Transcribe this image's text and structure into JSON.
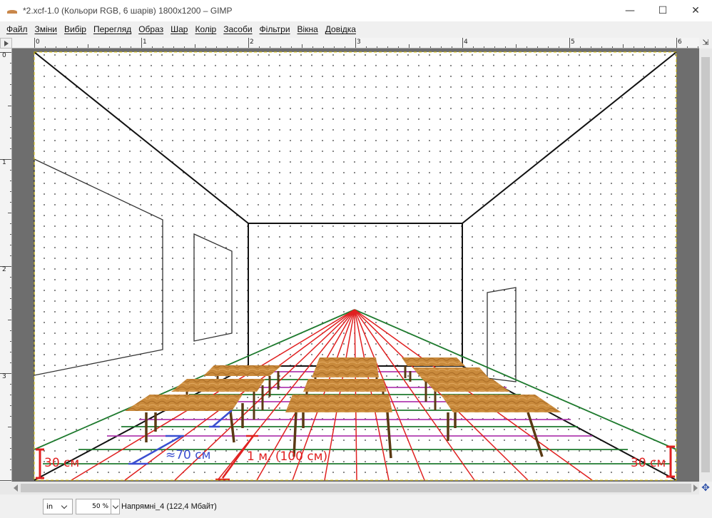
{
  "window": {
    "title": "*2.xcf-1.0 (Кольори RGB, 6 шарів) 1800x1200 – GIMP",
    "minimize": "—",
    "maximize": "☐",
    "close": "✕"
  },
  "menu": [
    "Файл",
    "Зміни",
    "Вибір",
    "Перегляд",
    "Образ",
    "Шар",
    "Колір",
    "Засоби",
    "Фільтри",
    "Вікна",
    "Довідка"
  ],
  "ruler": {
    "h_labels": [
      "0",
      "1",
      "2",
      "3",
      "4",
      "5",
      "6"
    ],
    "v_labels": [
      "0",
      "1",
      "2",
      "3"
    ]
  },
  "canvas": {
    "annotations": {
      "left_height": "30 см",
      "right_height": "30 см",
      "gap": "≈70 см",
      "length": "1 м. (100 см)"
    },
    "colors": {
      "red": "#e02020",
      "green": "#1e7a2e",
      "magenta": "#b03cb0",
      "blue": "#3a4ed0",
      "wood": "#c98a3c",
      "leg": "#5a3a14"
    }
  },
  "status": {
    "unit": "in",
    "zoom": "50 %",
    "message": "Напрямні_4 (122,4 Мбайт)"
  }
}
